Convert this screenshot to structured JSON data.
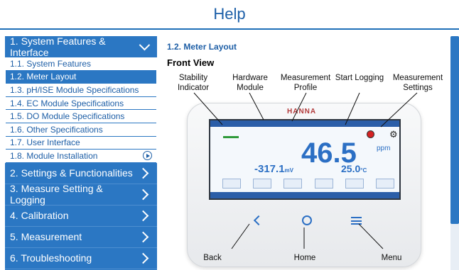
{
  "header": {
    "title": "Help"
  },
  "sidebar": {
    "open_section": {
      "label": "1. System Features & Interface"
    },
    "sub_items": [
      {
        "label": "1.1. System Features",
        "active": false
      },
      {
        "label": "1.2. Meter Layout",
        "active": true
      },
      {
        "label": "1.3. pH/ISE Module Specifications",
        "active": false
      },
      {
        "label": "1.4. EC Module Specifications",
        "active": false
      },
      {
        "label": "1.5. DO Module Specifications",
        "active": false
      },
      {
        "label": "1.6. Other Specifications",
        "active": false
      },
      {
        "label": "1.7. User Interface",
        "active": false
      },
      {
        "label": "1.8. Module Installation",
        "active": false
      }
    ],
    "sections": [
      {
        "label": "2. Settings & Functionalities"
      },
      {
        "label": "3. Measure Setting & Logging"
      },
      {
        "label": "4. Calibration"
      },
      {
        "label": "5. Measurement"
      },
      {
        "label": "6. Troubleshooting"
      }
    ]
  },
  "content": {
    "section_title": "1.2.  Meter Layout",
    "front_view": "Front View",
    "labels": {
      "stability": "Stability Indicator",
      "hardware": "Hardware Module",
      "profile": "Measurement Profile",
      "logging": "Start Logging",
      "settings": "Measurement Settings",
      "back": "Back",
      "home": "Home",
      "menu": "Menu"
    },
    "device": {
      "brand": "HANNA",
      "main_value": "46.5",
      "main_unit": "ppm",
      "mv_value": "-317.1",
      "mv_unit": "mV",
      "temp_value": "25.0",
      "temp_unit": "°C"
    }
  },
  "colors": {
    "accent": "#2b77c3",
    "header_text": "#1c5fa8",
    "record": "#d52222"
  }
}
